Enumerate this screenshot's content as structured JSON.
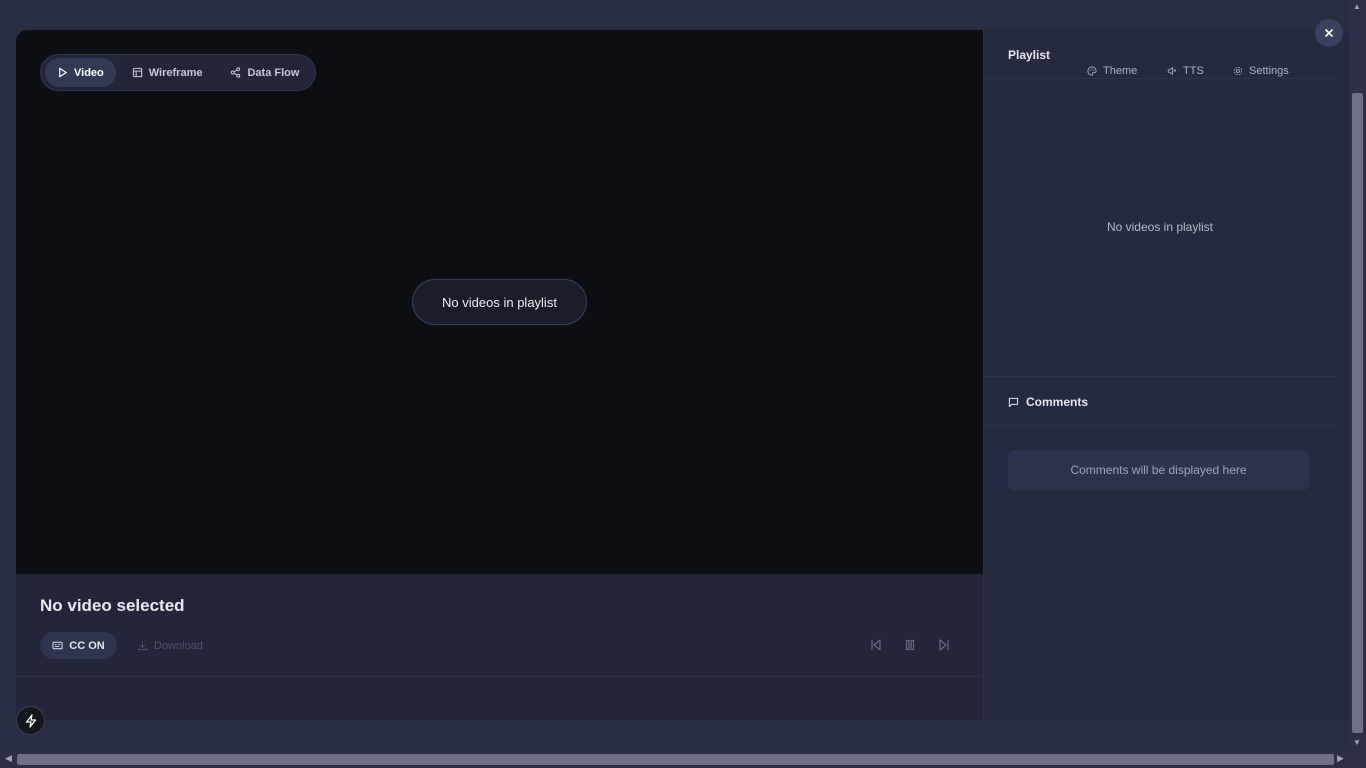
{
  "view_tabs": [
    {
      "label": "Video",
      "icon": "play-icon",
      "active": true
    },
    {
      "label": "Wireframe",
      "icon": "layout-icon",
      "active": false
    },
    {
      "label": "Data Flow",
      "icon": "share-icon",
      "active": false
    }
  ],
  "player": {
    "empty_message": "No videos in playlist"
  },
  "info": {
    "title": "No video selected",
    "cc_label": "CC ON",
    "download_label": "Download"
  },
  "sidebar": {
    "playlist_title": "Playlist",
    "tabs": [
      {
        "label": "Theme",
        "icon": "palette-icon"
      },
      {
        "label": "TTS",
        "icon": "speaker-icon"
      },
      {
        "label": "Settings",
        "icon": "gear-icon"
      }
    ],
    "playlist_empty": "No videos in playlist",
    "comments_title": "Comments",
    "comments_placeholder": "Comments will be displayed here"
  },
  "colors": {
    "background": "#2a2e44",
    "player": "#0e0f15",
    "panel": "#262a40",
    "accent_tab": "#343955"
  }
}
